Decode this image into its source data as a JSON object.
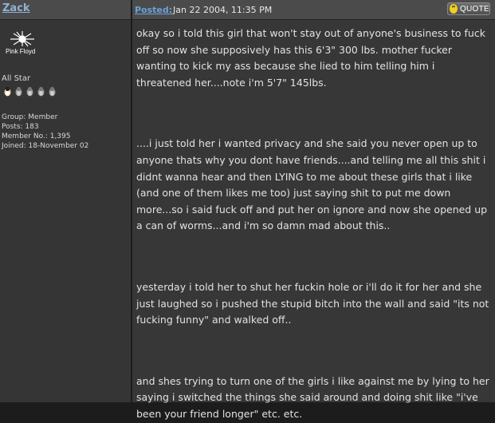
{
  "author": {
    "username": "Zack",
    "avatar_caption": "Pink Floyd",
    "rank": "All Star",
    "rank_pips": 5,
    "group": "Group: Member",
    "posts": "Posts: 183",
    "member_no": "Member No.: 1,395",
    "joined": "Joined: 18-November 02"
  },
  "post": {
    "posted_label": "Posted:",
    "date": "Jan 22 2004, 11:35 PM",
    "quote_label": "QUOTE",
    "paragraphs": [
      "okay so i told this girl that won't stay out of anyone's business to fuck off so now she supposively has this 6'3\" 300 lbs. mother fucker wanting to kick my ass because she lied to him telling him i threatened her....note i'm 5'7\" 145lbs.",
      "....i just told her i wanted privacy and she said you never open up to anyone thats why you dont have friends....and telling me all this shit i didnt wanna hear and then LYING to me about these girls that i like (and one of them likes me too) just saying shit to put me down more...so i said fuck off and put her on ignore and now she opened up a can of worms...and i'm so damn mad about this..",
      "yesterday i told her to shut her fuckin hole or i'll do it for her and she just laughed so i pushed the stupid bitch into the wall and said \"its not fucking funny\" and walked off..",
      "and shes trying to turn one of the girls i like against me by lying to her saying i switched the things she said around and doing shit like \"i've been your friend longer\" etc. etc."
    ]
  },
  "colors": {
    "header_bg": "#4b4b4b",
    "panel_bg": "#353535",
    "link": "#8fb3d6",
    "text": "#e2e2e2"
  }
}
